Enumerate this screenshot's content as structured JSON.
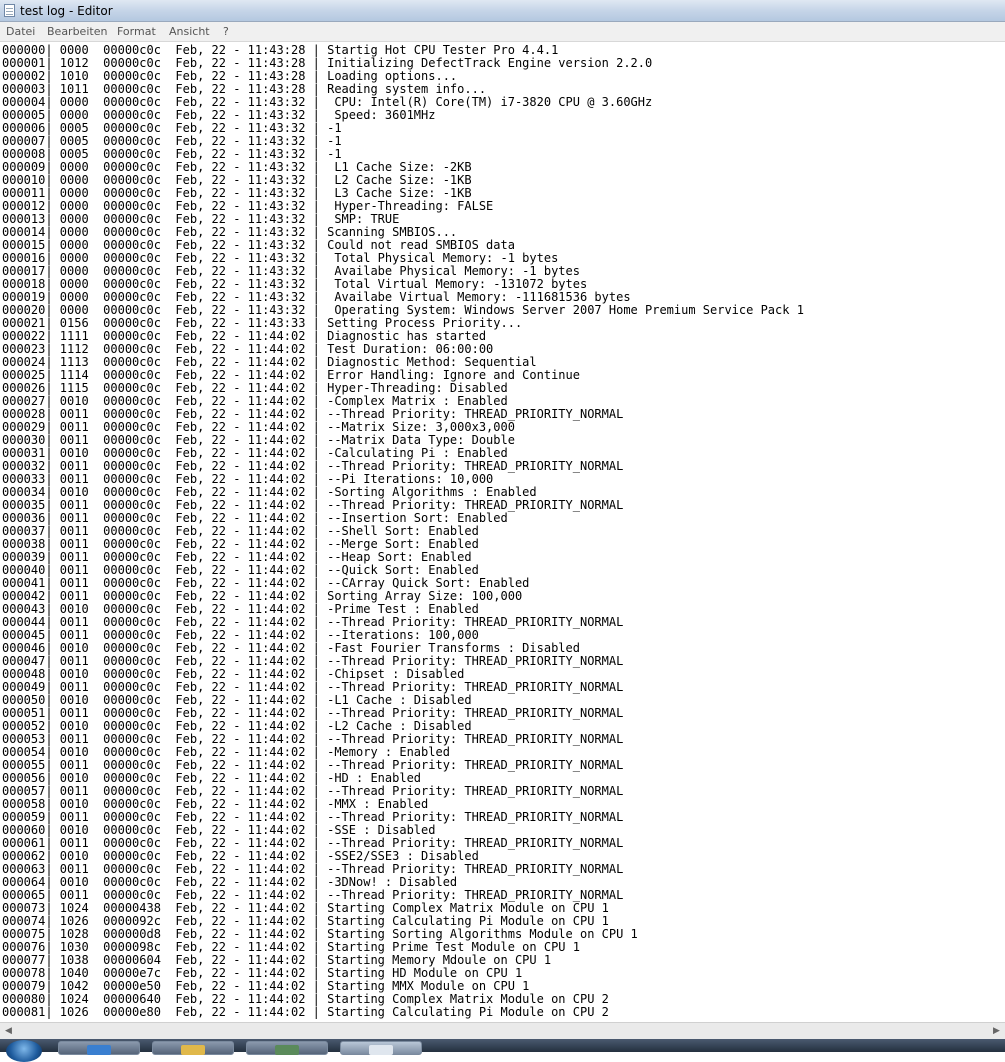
{
  "window": {
    "title": "test log - Editor"
  },
  "menu": [
    "Datei",
    "Bearbeiten",
    "Format",
    "Ansicht",
    "?"
  ],
  "log_lines": [
    "000000| 0000  00000c0c  Feb, 22 - 11:43:28 | Startig Hot CPU Tester Pro 4.4.1",
    "000001| 1012  00000c0c  Feb, 22 - 11:43:28 | Initializing DefectTrack Engine version 2.2.0",
    "000002| 1010  00000c0c  Feb, 22 - 11:43:28 | Loading options...",
    "000003| 1011  00000c0c  Feb, 22 - 11:43:28 | Reading system info...",
    "000004| 0000  00000c0c  Feb, 22 - 11:43:32 |  CPU: Intel(R) Core(TM) i7-3820 CPU @ 3.60GHz",
    "000005| 0000  00000c0c  Feb, 22 - 11:43:32 |  Speed: 3601MHz",
    "000006| 0005  00000c0c  Feb, 22 - 11:43:32 | -1",
    "000007| 0005  00000c0c  Feb, 22 - 11:43:32 | -1",
    "000008| 0005  00000c0c  Feb, 22 - 11:43:32 | -1",
    "000009| 0000  00000c0c  Feb, 22 - 11:43:32 |  L1 Cache Size: -2KB",
    "000010| 0000  00000c0c  Feb, 22 - 11:43:32 |  L2 Cache Size: -1KB",
    "000011| 0000  00000c0c  Feb, 22 - 11:43:32 |  L3 Cache Size: -1KB",
    "000012| 0000  00000c0c  Feb, 22 - 11:43:32 |  Hyper-Threading: FALSE",
    "000013| 0000  00000c0c  Feb, 22 - 11:43:32 |  SMP: TRUE",
    "000014| 0000  00000c0c  Feb, 22 - 11:43:32 | Scanning SMBIOS...",
    "000015| 0000  00000c0c  Feb, 22 - 11:43:32 | Could not read SMBIOS data",
    "000016| 0000  00000c0c  Feb, 22 - 11:43:32 |  Total Physical Memory: -1 bytes",
    "000017| 0000  00000c0c  Feb, 22 - 11:43:32 |  Availabe Physical Memory: -1 bytes",
    "000018| 0000  00000c0c  Feb, 22 - 11:43:32 |  Total Virtual Memory: -131072 bytes",
    "000019| 0000  00000c0c  Feb, 22 - 11:43:32 |  Availabe Virtual Memory: -111681536 bytes",
    "000020| 0000  00000c0c  Feb, 22 - 11:43:32 |  Operating System: Windows Server 2007 Home Premium Service Pack 1",
    "000021| 0156  00000c0c  Feb, 22 - 11:43:33 | Setting Process Priority...",
    "000022| 1111  00000c0c  Feb, 22 - 11:44:02 | Diagnostic has started",
    "000023| 1112  00000c0c  Feb, 22 - 11:44:02 | Test Duration: 06:00:00",
    "000024| 1113  00000c0c  Feb, 22 - 11:44:02 | Diagnostic Method: Sequential",
    "000025| 1114  00000c0c  Feb, 22 - 11:44:02 | Error Handling: Ignore and Continue",
    "000026| 1115  00000c0c  Feb, 22 - 11:44:02 | Hyper-Threading: Disabled",
    "000027| 0010  00000c0c  Feb, 22 - 11:44:02 | -Complex Matrix : Enabled",
    "000028| 0011  00000c0c  Feb, 22 - 11:44:02 | --Thread Priority: THREAD_PRIORITY_NORMAL",
    "000029| 0011  00000c0c  Feb, 22 - 11:44:02 | --Matrix Size: 3,000x3,000",
    "000030| 0011  00000c0c  Feb, 22 - 11:44:02 | --Matrix Data Type: Double",
    "000031| 0010  00000c0c  Feb, 22 - 11:44:02 | -Calculating Pi : Enabled",
    "000032| 0011  00000c0c  Feb, 22 - 11:44:02 | --Thread Priority: THREAD_PRIORITY_NORMAL",
    "000033| 0011  00000c0c  Feb, 22 - 11:44:02 | --Pi Iterations: 10,000",
    "000034| 0010  00000c0c  Feb, 22 - 11:44:02 | -Sorting Algorithms : Enabled",
    "000035| 0011  00000c0c  Feb, 22 - 11:44:02 | --Thread Priority: THREAD_PRIORITY_NORMAL",
    "000036| 0011  00000c0c  Feb, 22 - 11:44:02 | --Insertion Sort: Enabled",
    "000037| 0011  00000c0c  Feb, 22 - 11:44:02 | --Shell Sort: Enabled",
    "000038| 0011  00000c0c  Feb, 22 - 11:44:02 | --Merge Sort: Enabled",
    "000039| 0011  00000c0c  Feb, 22 - 11:44:02 | --Heap Sort: Enabled",
    "000040| 0011  00000c0c  Feb, 22 - 11:44:02 | --Quick Sort: Enabled",
    "000041| 0011  00000c0c  Feb, 22 - 11:44:02 | --CArray Quick Sort: Enabled",
    "000042| 0011  00000c0c  Feb, 22 - 11:44:02 | Sorting Array Size: 100,000",
    "000043| 0010  00000c0c  Feb, 22 - 11:44:02 | -Prime Test : Enabled",
    "000044| 0011  00000c0c  Feb, 22 - 11:44:02 | --Thread Priority: THREAD_PRIORITY_NORMAL",
    "000045| 0011  00000c0c  Feb, 22 - 11:44:02 | --Iterations: 100,000",
    "000046| 0010  00000c0c  Feb, 22 - 11:44:02 | -Fast Fourier Transforms : Disabled",
    "000047| 0011  00000c0c  Feb, 22 - 11:44:02 | --Thread Priority: THREAD_PRIORITY_NORMAL",
    "000048| 0010  00000c0c  Feb, 22 - 11:44:02 | -Chipset : Disabled",
    "000049| 0011  00000c0c  Feb, 22 - 11:44:02 | --Thread Priority: THREAD_PRIORITY_NORMAL",
    "000050| 0010  00000c0c  Feb, 22 - 11:44:02 | -L1 Cache : Disabled",
    "000051| 0011  00000c0c  Feb, 22 - 11:44:02 | --Thread Priority: THREAD_PRIORITY_NORMAL",
    "000052| 0010  00000c0c  Feb, 22 - 11:44:02 | -L2 Cache : Disabled",
    "000053| 0011  00000c0c  Feb, 22 - 11:44:02 | --Thread Priority: THREAD_PRIORITY_NORMAL",
    "000054| 0010  00000c0c  Feb, 22 - 11:44:02 | -Memory : Enabled",
    "000055| 0011  00000c0c  Feb, 22 - 11:44:02 | --Thread Priority: THREAD_PRIORITY_NORMAL",
    "000056| 0010  00000c0c  Feb, 22 - 11:44:02 | -HD : Enabled",
    "000057| 0011  00000c0c  Feb, 22 - 11:44:02 | --Thread Priority: THREAD_PRIORITY_NORMAL",
    "000058| 0010  00000c0c  Feb, 22 - 11:44:02 | -MMX : Enabled",
    "000059| 0011  00000c0c  Feb, 22 - 11:44:02 | --Thread Priority: THREAD_PRIORITY_NORMAL",
    "000060| 0010  00000c0c  Feb, 22 - 11:44:02 | -SSE : Disabled",
    "000061| 0011  00000c0c  Feb, 22 - 11:44:02 | --Thread Priority: THREAD_PRIORITY_NORMAL",
    "000062| 0010  00000c0c  Feb, 22 - 11:44:02 | -SSE2/SSE3 : Disabled",
    "000063| 0011  00000c0c  Feb, 22 - 11:44:02 | --Thread Priority: THREAD_PRIORITY_NORMAL",
    "000064| 0010  00000c0c  Feb, 22 - 11:44:02 | -3DNow! : Disabled",
    "000065| 0011  00000c0c  Feb, 22 - 11:44:02 | --Thread Priority: THREAD_PRIORITY_NORMAL",
    "000073| 1024  00000438  Feb, 22 - 11:44:02 | Starting Complex Matrix Module on CPU 1",
    "000074| 1026  0000092c  Feb, 22 - 11:44:02 | Starting Calculating Pi Module on CPU 1",
    "000075| 1028  000000d8  Feb, 22 - 11:44:02 | Starting Sorting Algorithms Module on CPU 1",
    "000076| 1030  0000098c  Feb, 22 - 11:44:02 | Starting Prime Test Module on CPU 1",
    "000077| 1038  00000604  Feb, 22 - 11:44:02 | Starting Memory Mdoule on CPU 1",
    "000078| 1040  00000e7c  Feb, 22 - 11:44:02 | Starting HD Module on CPU 1",
    "000079| 1042  00000e50  Feb, 22 - 11:44:02 | Starting MMX Module on CPU 1",
    "000080| 1024  00000640  Feb, 22 - 11:44:02 | Starting Complex Matrix Module on CPU 2",
    "000081| 1026  00000e80  Feb, 22 - 11:44:02 | Starting Calculating Pi Module on CPU 2"
  ],
  "taskbar": {
    "items": [
      {
        "icon": "ie-icon",
        "color": "#3a7fd0"
      },
      {
        "icon": "folder-icon",
        "color": "#e0b84a"
      },
      {
        "icon": "app-icon",
        "color": "#5a8a5a"
      },
      {
        "icon": "notepad-icon",
        "color": "#dfe6ee",
        "active": true
      }
    ]
  }
}
